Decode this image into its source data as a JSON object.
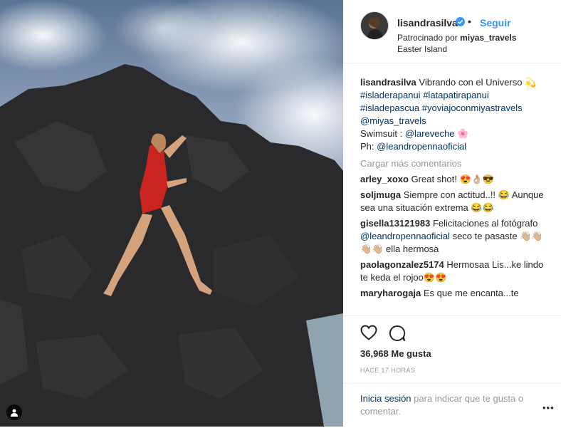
{
  "post": {
    "username": "lisandrasilva",
    "dot": "•",
    "follow_label": "Seguir",
    "sponsored_prefix": "Patrocinado por",
    "sponsor": "miyas_travels",
    "location": "Easter Island"
  },
  "caption": {
    "username": "lisandrasilva",
    "text": "Vibrando con el Universo",
    "text_emoji": "💫",
    "hashtag1": "#isladerapanui",
    "hashtag2": "#latapatirapanui",
    "hashtag3": "#isladepascua",
    "hashtag4": "#yoviajoconmiyastravels",
    "mention": "@miyas_travels",
    "swimsuit_prefix": "Swimsuit :",
    "swimsuit_mention": "@lareveche",
    "swimsuit_emoji": "🌸",
    "ph_prefix": "Ph:",
    "ph_mention": "@leandropennaoficial"
  },
  "load_more": "Cargar más comentarios",
  "comments": [
    {
      "user": "arley_xoxo",
      "text": "Great shot! 😍👌🏼😎"
    },
    {
      "user": "soljmuga",
      "text": "Siempre con actitud..!! 😂 Aunque sea una situación extrema 😂😂"
    },
    {
      "user": "gisella13121983",
      "text": "Felicitaciones al fotógrafo",
      "mention": "@leandropennaoficial",
      "text2": "seco te pasaste 👋🏼👋🏼 👋🏼👋🏼 ella hermosa"
    },
    {
      "user": "paolagonzalez5174",
      "text": "Hermosaa Lis...ke lindo te keda el rojoo😍😍"
    },
    {
      "user": "maryharogaja",
      "text": "Es que me encanta...te"
    }
  ],
  "likes": "36,968 Me gusta",
  "timestamp": "HACE 17 HORAS",
  "login": {
    "link": "Inicia sesión",
    "text": "para indicar que te gusta o comentar."
  },
  "more_icon": "•••",
  "colors": {
    "link": "#003569",
    "follow": "#3897f0",
    "muted": "#999999"
  }
}
